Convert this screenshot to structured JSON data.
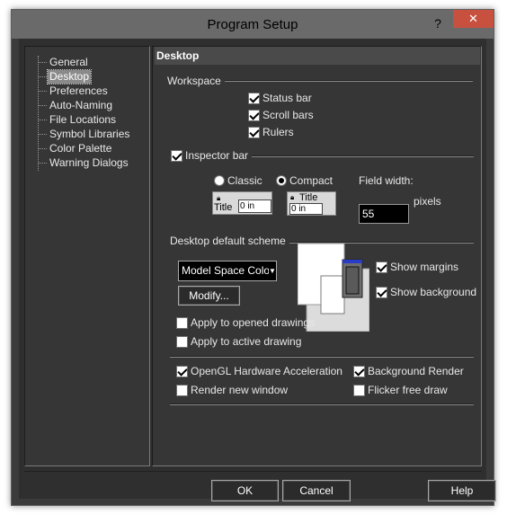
{
  "window": {
    "title": "Program Setup",
    "help_glyph": "?",
    "close_glyph": "✕"
  },
  "tree": {
    "items": [
      {
        "label": "General"
      },
      {
        "label": "Desktop",
        "selected": true
      },
      {
        "label": "Preferences"
      },
      {
        "label": "Auto-Naming"
      },
      {
        "label": "File Locations"
      },
      {
        "label": "Symbol Libraries"
      },
      {
        "label": "Color Palette"
      },
      {
        "label": "Warning Dialogs"
      }
    ]
  },
  "page": {
    "header": "Desktop",
    "workspace": {
      "label": "Workspace",
      "status_bar": {
        "label": "Status bar",
        "checked": true
      },
      "scroll_bars": {
        "label": "Scroll bars",
        "checked": true
      },
      "rulers": {
        "label": "Rulers",
        "checked": true
      }
    },
    "inspector": {
      "label": "Inspector bar",
      "checked": true,
      "classic": {
        "label": "Classic",
        "selected": false
      },
      "compact": {
        "label": "Compact",
        "selected": true
      },
      "preview_title": "Title",
      "preview_value": "0 in",
      "field_width_label": "Field width:",
      "field_width_value": "55",
      "pixels_label": "pixels"
    },
    "scheme": {
      "label": "Desktop default scheme",
      "selected": "Model Space Color",
      "modify_label": "Modify...",
      "show_margins": {
        "label": "Show margins",
        "checked": true
      },
      "show_background": {
        "label": "Show background",
        "checked": true
      },
      "apply_opened": {
        "label": "Apply to opened drawings",
        "checked": false
      },
      "apply_active": {
        "label": "Apply to active drawing",
        "checked": false
      }
    },
    "render": {
      "opengl": {
        "label": "OpenGL Hardware Acceleration",
        "checked": true
      },
      "background_render": {
        "label": "Background Render",
        "checked": true
      },
      "render_new_window": {
        "label": "Render new window",
        "checked": false
      },
      "flicker_free": {
        "label": "Flicker free draw",
        "checked": false
      }
    }
  },
  "buttons": {
    "ok": "OK",
    "cancel": "Cancel",
    "help": "Help"
  },
  "colors": {
    "window_bg": "#3b3b3b",
    "title_bar": "#6a6a6a",
    "close_button": "#c7503f",
    "pane_bg": "#363636",
    "selected_item": "#8a8a8a"
  }
}
